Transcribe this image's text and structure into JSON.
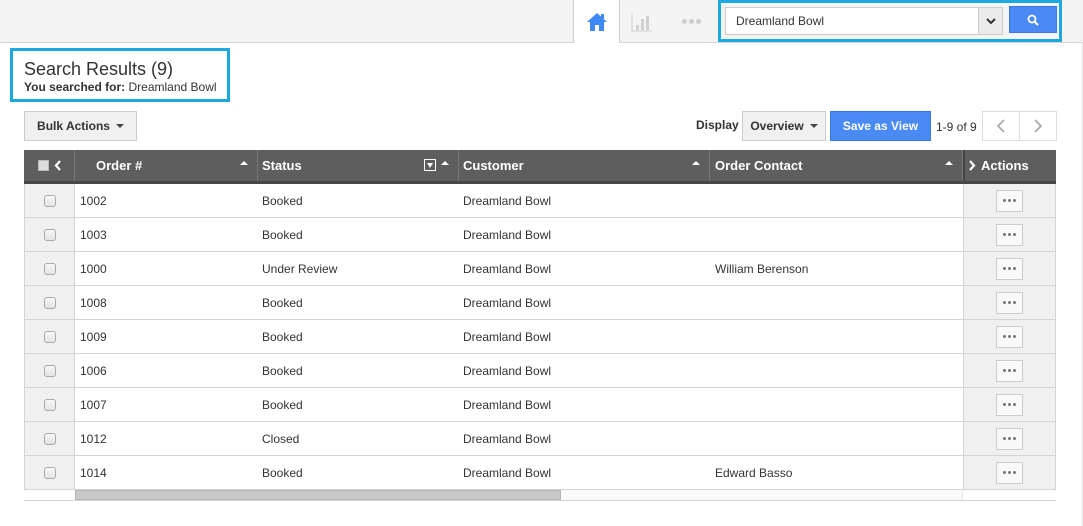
{
  "topbar": {
    "nav": [
      {
        "name": "home",
        "icon": "home-icon",
        "active": true
      },
      {
        "name": "reports",
        "icon": "bar-chart-icon",
        "active": false
      },
      {
        "name": "more",
        "icon": "more-horizontal-icon",
        "active": false
      }
    ],
    "search": {
      "value": "Dreamland Bowl",
      "dropdown_icon": "chevron-down-icon",
      "button_icon": "search-icon"
    }
  },
  "results": {
    "title": "Search Results (9)",
    "searched_label": "You searched for:",
    "searched_value": "Dreamland Bowl"
  },
  "toolbar": {
    "bulk_actions_label": "Bulk Actions",
    "display_label": "Display",
    "display_value": "Overview",
    "save_view_label": "Save as View",
    "page_info": "1-9 of 9",
    "prev_icon": "chevron-left-icon",
    "next_icon": "chevron-right-icon"
  },
  "grid": {
    "columns": {
      "order": "Order #",
      "status": "Status",
      "customer": "Customer",
      "contact": "Order Contact",
      "actions": "Actions"
    },
    "rows": [
      {
        "order": "1002",
        "status": "Booked",
        "customer": "Dreamland Bowl",
        "contact": ""
      },
      {
        "order": "1003",
        "status": "Booked",
        "customer": "Dreamland Bowl",
        "contact": ""
      },
      {
        "order": "1000",
        "status": "Under Review",
        "customer": "Dreamland Bowl",
        "contact": "William Berenson"
      },
      {
        "order": "1008",
        "status": "Booked",
        "customer": "Dreamland Bowl",
        "contact": ""
      },
      {
        "order": "1009",
        "status": "Booked",
        "customer": "Dreamland Bowl",
        "contact": ""
      },
      {
        "order": "1006",
        "status": "Booked",
        "customer": "Dreamland Bowl",
        "contact": ""
      },
      {
        "order": "1007",
        "status": "Booked",
        "customer": "Dreamland Bowl",
        "contact": ""
      },
      {
        "order": "1012",
        "status": "Closed",
        "customer": "Dreamland Bowl",
        "contact": ""
      },
      {
        "order": "1014",
        "status": "Booked",
        "customer": "Dreamland Bowl",
        "contact": "Edward Basso"
      }
    ]
  },
  "colors": {
    "accent": "#4a8af4",
    "highlight_border": "#1ba9e0",
    "header_bg": "#5e5e5e",
    "home_icon": "#3d8af7"
  }
}
